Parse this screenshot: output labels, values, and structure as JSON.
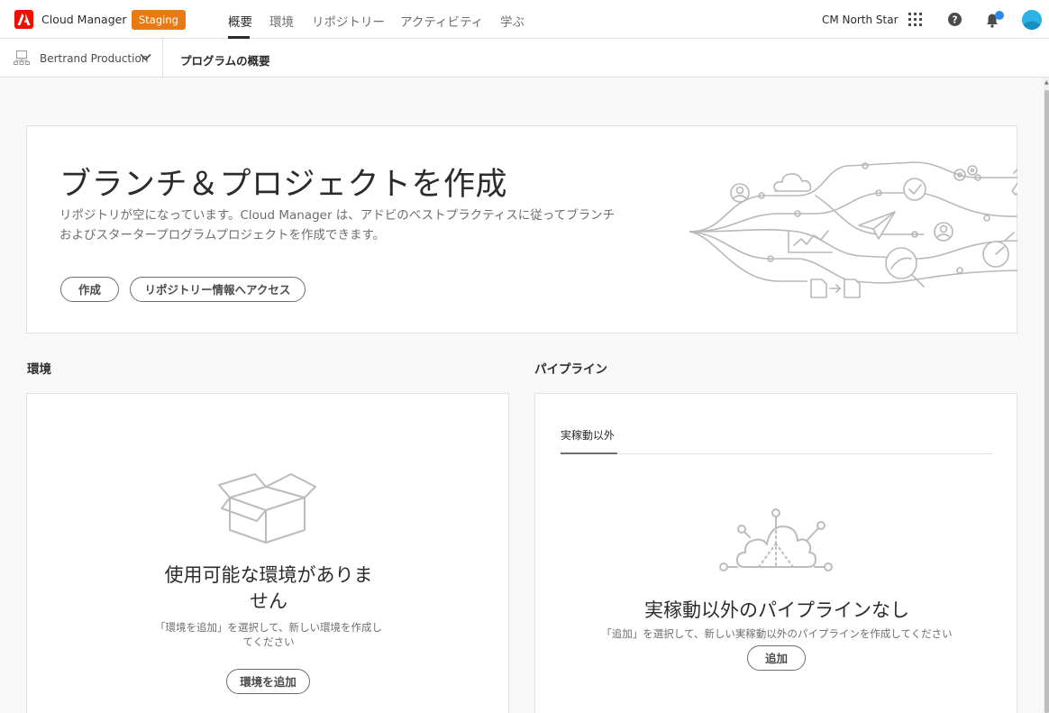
{
  "header": {
    "app_name": "Cloud Manager",
    "env_badge": "Staging",
    "nav": [
      "概要",
      "環境",
      "リポジトリー",
      "アクティビティ",
      "学ぶ"
    ],
    "active_nav": "概要",
    "org_name": "CM North Star",
    "icons": [
      "adobe-logo-icon",
      "app-switcher-icon",
      "help-icon",
      "notification-bell-icon",
      "user-avatar"
    ],
    "colors": {
      "logo": "#eb1000",
      "badge": "#e87a13",
      "notification_dot": "#2d8ceb",
      "avatar": "#2bb3e6"
    }
  },
  "subheader": {
    "program_name": "Bertrand Production",
    "page_title": "プログラムの概要"
  },
  "hero": {
    "title": "ブランチ＆プロジェクトを作成",
    "desc_line1": "リポジトリが空になっています。Cloud Manager は、アドビのベストプラクティスに従ってブランチ",
    "desc_line2": "およびスタータープログラムプロジェクトを作成できます。",
    "create_label": "作成",
    "repo_label": "リポジトリー情報へアクセス"
  },
  "environments": {
    "heading": "環境",
    "empty_title_line1": "使用可能な環境がありま",
    "empty_title_line2": "せん",
    "empty_desc_line1": "「環境を追加」を選択して、新しい環境を作成し",
    "empty_desc_line2": "てください",
    "add_label": "環境を追加"
  },
  "pipelines": {
    "heading": "パイプライン",
    "tab_label": "実稼動以外",
    "empty_title": "実稼動以外のパイプラインなし",
    "empty_desc": "「追加」を選択して、新しい実稼動以外のパイプラインを作成してください",
    "add_label": "追加"
  }
}
